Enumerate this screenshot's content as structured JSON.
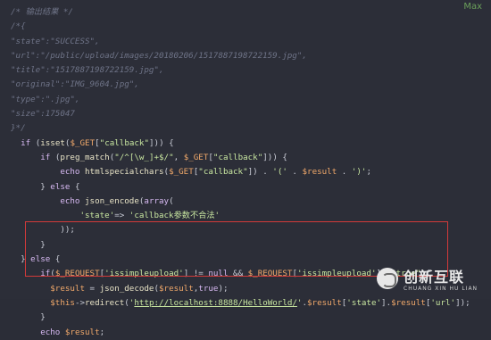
{
  "top_right_label": "Max",
  "code_lines": [
    {
      "parts": [
        {
          "c": "cm",
          "t": "/* 输出结果 */"
        }
      ]
    },
    {
      "parts": [
        {
          "c": "cm",
          "t": "/*{"
        }
      ]
    },
    {
      "parts": [
        {
          "c": "cm",
          "t": "\"state\":\"SUCCESS\","
        }
      ]
    },
    {
      "parts": [
        {
          "c": "cm",
          "t": "\"url\":\"/public/upload/images/20180206/1517887198722159.jpg\","
        }
      ]
    },
    {
      "parts": [
        {
          "c": "cm",
          "t": "\"title\":\"1517887198722159.jpg\","
        }
      ]
    },
    {
      "parts": [
        {
          "c": "cm",
          "t": "\"original\":\"IMG_9604.jpg\","
        }
      ]
    },
    {
      "parts": [
        {
          "c": "cm",
          "t": "\"type\":\".jpg\","
        }
      ]
    },
    {
      "parts": [
        {
          "c": "cm",
          "t": "\"size\":175047"
        }
      ]
    },
    {
      "parts": [
        {
          "c": "cm",
          "t": "}*/"
        }
      ]
    },
    {
      "parts": [
        {
          "c": "kw",
          "t": "if "
        },
        {
          "c": "op",
          "t": "("
        },
        {
          "c": "fn",
          "t": "isset"
        },
        {
          "c": "op",
          "t": "("
        },
        {
          "c": "var",
          "t": "$_GET"
        },
        {
          "c": "op",
          "t": "["
        },
        {
          "c": "str",
          "t": "\"callback\""
        },
        {
          "c": "op",
          "t": "])) {"
        }
      ],
      "indent": "  "
    },
    {
      "parts": [
        {
          "c": "kw",
          "t": "if "
        },
        {
          "c": "op",
          "t": "("
        },
        {
          "c": "fn",
          "t": "preg_match"
        },
        {
          "c": "op",
          "t": "("
        },
        {
          "c": "str",
          "t": "\"/^[\\w_]+$/\""
        },
        {
          "c": "op",
          "t": ", "
        },
        {
          "c": "var",
          "t": "$_GET"
        },
        {
          "c": "op",
          "t": "["
        },
        {
          "c": "str",
          "t": "\"callback\""
        },
        {
          "c": "op",
          "t": "])) {"
        }
      ],
      "indent": "      "
    },
    {
      "parts": [
        {
          "c": "kw",
          "t": "echo "
        },
        {
          "c": "fn",
          "t": "htmlspecialchars"
        },
        {
          "c": "op",
          "t": "("
        },
        {
          "c": "var",
          "t": "$_GET"
        },
        {
          "c": "op",
          "t": "["
        },
        {
          "c": "str",
          "t": "\"callback\""
        },
        {
          "c": "op",
          "t": "]) . "
        },
        {
          "c": "str",
          "t": "'('"
        },
        {
          "c": "op",
          "t": " . "
        },
        {
          "c": "var",
          "t": "$result"
        },
        {
          "c": "op",
          "t": " . "
        },
        {
          "c": "str",
          "t": "')'"
        },
        {
          "c": "op",
          "t": ";"
        }
      ],
      "indent": "          "
    },
    {
      "parts": [
        {
          "c": "op",
          "t": "} "
        },
        {
          "c": "kw",
          "t": "else"
        },
        {
          "c": "op",
          "t": " {"
        }
      ],
      "indent": "      "
    },
    {
      "parts": [
        {
          "c": "kw",
          "t": "echo "
        },
        {
          "c": "fn",
          "t": "json_encode"
        },
        {
          "c": "op",
          "t": "("
        },
        {
          "c": "kw",
          "t": "array"
        },
        {
          "c": "op",
          "t": "("
        }
      ],
      "indent": "          "
    },
    {
      "parts": [
        {
          "c": "str",
          "t": "'state'"
        },
        {
          "c": "op",
          "t": "=> "
        },
        {
          "c": "str",
          "t": "'callback参数不合法'"
        }
      ],
      "indent": "              "
    },
    {
      "parts": [
        {
          "c": "op",
          "t": "));"
        }
      ],
      "indent": "          "
    },
    {
      "parts": [
        {
          "c": "op",
          "t": "}"
        }
      ],
      "indent": "      "
    },
    {
      "parts": [
        {
          "c": "op",
          "t": "} "
        },
        {
          "c": "kw",
          "t": "else"
        },
        {
          "c": "op",
          "t": " {"
        }
      ],
      "indent": "  "
    },
    {
      "parts": [
        {
          "c": "kw",
          "t": "if"
        },
        {
          "c": "op",
          "t": "("
        },
        {
          "c": "var",
          "t": "$_REQUEST"
        },
        {
          "c": "op",
          "t": "["
        },
        {
          "c": "str",
          "t": "'issimpleupload'"
        },
        {
          "c": "op",
          "t": "] != "
        },
        {
          "c": "kw",
          "t": "null"
        },
        {
          "c": "op",
          "t": " && "
        },
        {
          "c": "var",
          "t": "$_REQUEST"
        },
        {
          "c": "op",
          "t": "["
        },
        {
          "c": "str",
          "t": "'issimpleupload'"
        },
        {
          "c": "op",
          "t": "]=="
        },
        {
          "c": "str",
          "t": "\"true\""
        },
        {
          "c": "op",
          "t": "){"
        }
      ],
      "indent": "      "
    },
    {
      "parts": [
        {
          "c": "var",
          "t": "$result"
        },
        {
          "c": "op",
          "t": " = "
        },
        {
          "c": "fn",
          "t": "json_decode"
        },
        {
          "c": "op",
          "t": "("
        },
        {
          "c": "var",
          "t": "$result"
        },
        {
          "c": "op",
          "t": ","
        },
        {
          "c": "kw",
          "t": "true"
        },
        {
          "c": "op",
          "t": ");"
        }
      ],
      "indent": "        "
    },
    {
      "parts": [
        {
          "c": "var",
          "t": "$this"
        },
        {
          "c": "op",
          "t": "->"
        },
        {
          "c": "fn",
          "t": "redirect"
        },
        {
          "c": "op",
          "t": "("
        },
        {
          "c": "str",
          "t": "'"
        },
        {
          "c": "lnk",
          "t": "http://localhost:8888/HelloWorld/"
        },
        {
          "c": "str",
          "t": "'"
        },
        {
          "c": "op",
          "t": "."
        },
        {
          "c": "var",
          "t": "$result"
        },
        {
          "c": "op",
          "t": "["
        },
        {
          "c": "str",
          "t": "'state'"
        },
        {
          "c": "op",
          "t": "]."
        },
        {
          "c": "var",
          "t": "$result"
        },
        {
          "c": "op",
          "t": "["
        },
        {
          "c": "str",
          "t": "'url'"
        },
        {
          "c": "op",
          "t": "]);"
        }
      ],
      "indent": "        "
    },
    {
      "parts": [
        {
          "c": "op",
          "t": "}"
        }
      ],
      "indent": "      "
    },
    {
      "parts": [
        {
          "c": "kw",
          "t": "echo "
        },
        {
          "c": "var",
          "t": "$result"
        },
        {
          "c": "op",
          "t": ";"
        }
      ],
      "indent": "      "
    }
  ],
  "watermark": {
    "title": "创新互联",
    "subtitle": "CHUANG XIN HU LIAN"
  },
  "colors": {
    "highlight_box": "#d33a3a",
    "background": "#2c2e38"
  }
}
